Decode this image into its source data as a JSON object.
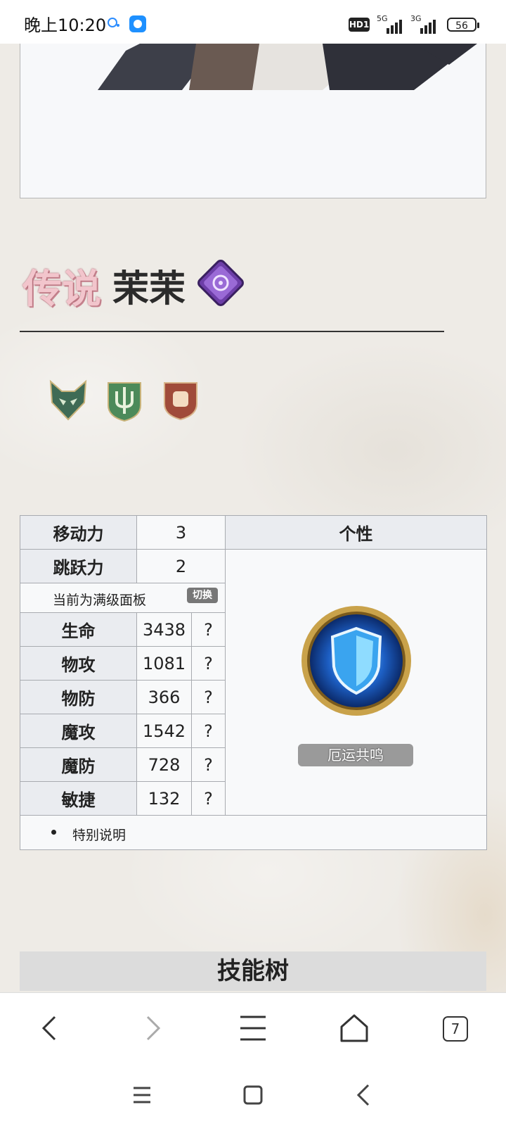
{
  "status_bar": {
    "time": "晚上10:20",
    "hd_label": "HD1",
    "sim1_label": "5G",
    "sim2_label": "3G",
    "battery": "56"
  },
  "character": {
    "rarity": "传说",
    "name": "茉茉",
    "class_icon": "purple-diamond-class-icon",
    "faction_icons": [
      "wolf-crest-icon",
      "trident-crest-icon",
      "fist-shield-icon"
    ]
  },
  "stats_table": {
    "move_label": "移动力",
    "move_value": "3",
    "jump_label": "跳跃力",
    "jump_value": "2",
    "trait_header": "个性",
    "panel_note": "当前为满级面板",
    "switch_button": "切换",
    "rows": [
      {
        "label": "生命",
        "value": "3438",
        "help": "?"
      },
      {
        "label": "物攻",
        "value": "1081",
        "help": "?"
      },
      {
        "label": "物防",
        "value": "366",
        "help": "?"
      },
      {
        "label": "魔攻",
        "value": "1542",
        "help": "?"
      },
      {
        "label": "魔防",
        "value": "728",
        "help": "?"
      },
      {
        "label": "敏捷",
        "value": "132",
        "help": "?"
      }
    ],
    "trait_name": "厄运共鸣",
    "special_note": "特别说明"
  },
  "skill_tree": {
    "title": "技能树"
  },
  "browser": {
    "tab_count": "7"
  }
}
